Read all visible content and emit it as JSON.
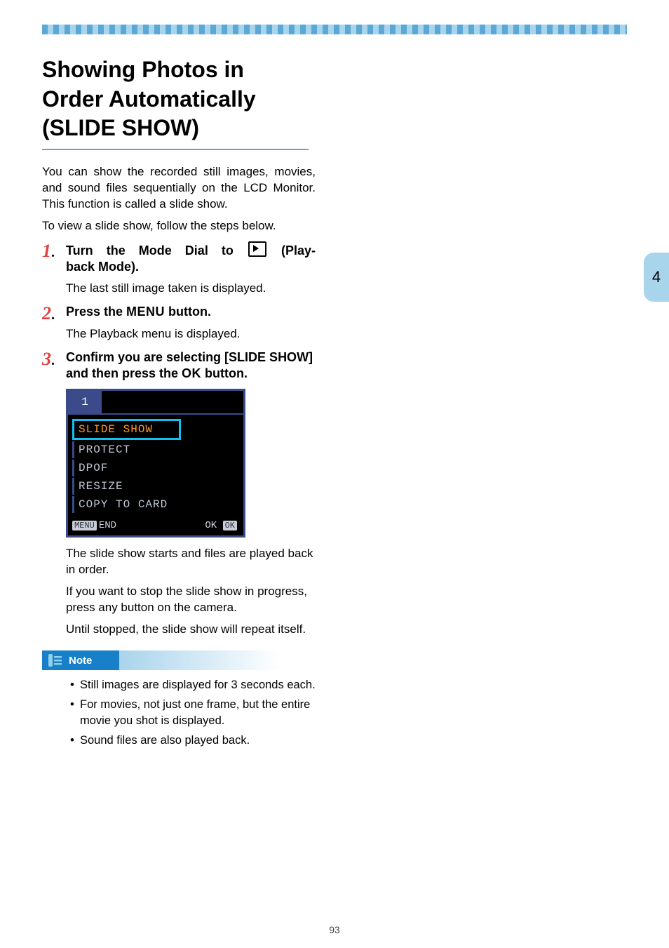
{
  "section_tab": "4",
  "title": "Showing Photos in Order Automatically (SLIDE SHOW)",
  "intro": [
    "You can show the recorded still images, movies, and sound files sequentially on the LCD Monitor. This function is called a slide show.",
    "To view a slide show, follow the steps below."
  ],
  "steps": [
    {
      "num": "1",
      "head_parts": [
        "Turn the Mode Dial to ",
        " (Playback Mode)."
      ],
      "desc": [
        "The last still image taken is displayed."
      ]
    },
    {
      "num": "2",
      "head_parts": [
        "Press the ",
        "MENU",
        " button."
      ],
      "desc": [
        "The Playback menu is displayed."
      ]
    },
    {
      "num": "3",
      "head_parts": [
        "Confirm you are selecting [SLIDE SHOW] and then press the ",
        "OK",
        " button."
      ],
      "desc": [
        "The slide show starts and files are played back in order.",
        "If you want to stop the slide show in progress, press any button on the camera.",
        "Until stopped, the slide show will repeat itself."
      ]
    }
  ],
  "lcd": {
    "tab": "1",
    "items": [
      "SLIDE SHOW",
      "PROTECT",
      "DPOF",
      "RESIZE",
      "COPY TO CARD"
    ],
    "selected_index": 0,
    "bottom_left_label": "MENU",
    "bottom_left_text": "END",
    "bottom_right_label": "OK",
    "bottom_right_text": "OK"
  },
  "note": {
    "label": "Note",
    "items": [
      "Still images are displayed for 3 seconds each.",
      "For movies, not just one frame, but the entire movie you shot is displayed.",
      "Sound files are also played back."
    ]
  },
  "page_number": "93"
}
